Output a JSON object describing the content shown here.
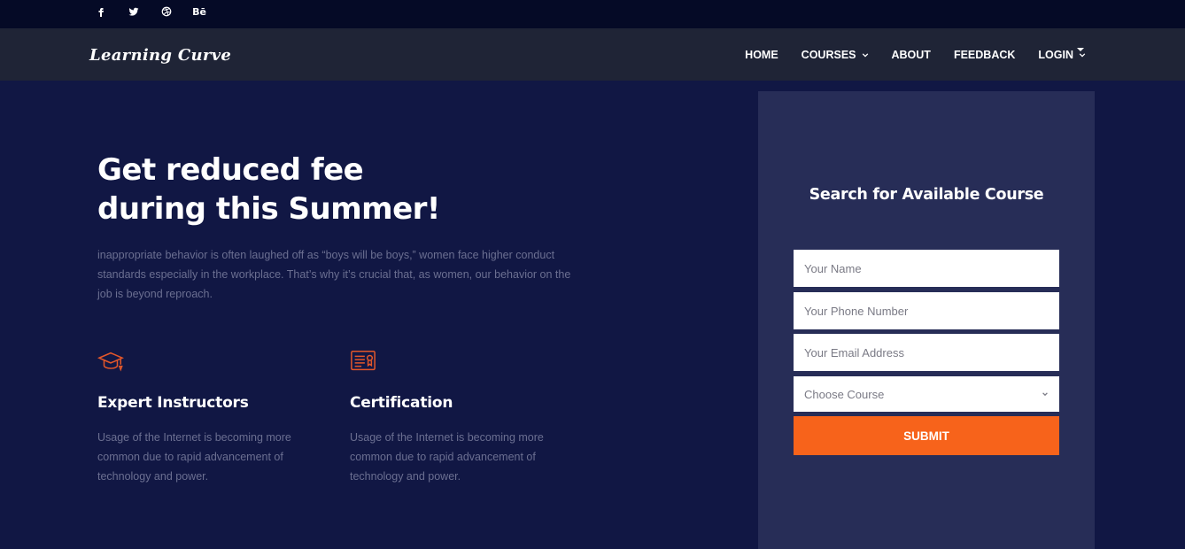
{
  "social": {
    "icons": [
      "facebook-icon",
      "twitter-icon",
      "dribbble-icon",
      "behance-icon"
    ],
    "behance_text": "Bē"
  },
  "brand": {
    "name": "Learning Curve"
  },
  "nav": {
    "items": [
      {
        "label": "HOME"
      },
      {
        "label": "COURSES"
      },
      {
        "label": "ABOUT"
      },
      {
        "label": "FEEDBACK"
      },
      {
        "label": "LOGIN"
      }
    ]
  },
  "hero": {
    "headline_line1": "Get reduced fee",
    "headline_line2": "during this Summer!",
    "intro": "inappropriate behavior is often laughed off as “boys will be boys,” women face higher conduct standards especially in the workplace. That’s why it’s crucial that, as women, our behavior on the job is beyond reproach."
  },
  "features": [
    {
      "title": "Expert Instructors",
      "icon": "graduation-cap-icon",
      "text": "Usage of the Internet is becoming more common due to rapid advancement of technology and power."
    },
    {
      "title": "Certification",
      "icon": "certificate-icon",
      "text": "Usage of the Internet is becoming more common due to rapid advancement of technology and power."
    }
  ],
  "form": {
    "title": "Search for Available Course",
    "name_placeholder": "Your Name",
    "phone_placeholder": "Your Phone Number",
    "email_placeholder": "Your Email Address",
    "course_select": "Choose Course",
    "submit_label": "SUBMIT"
  },
  "colors": {
    "page_bg": "#111744",
    "topbar_bg": "#050a26",
    "navbar_bg": "#1f2436",
    "panel_bg": "#272d57",
    "accent": "#f7631b",
    "icon_accent": "#e3572a"
  }
}
